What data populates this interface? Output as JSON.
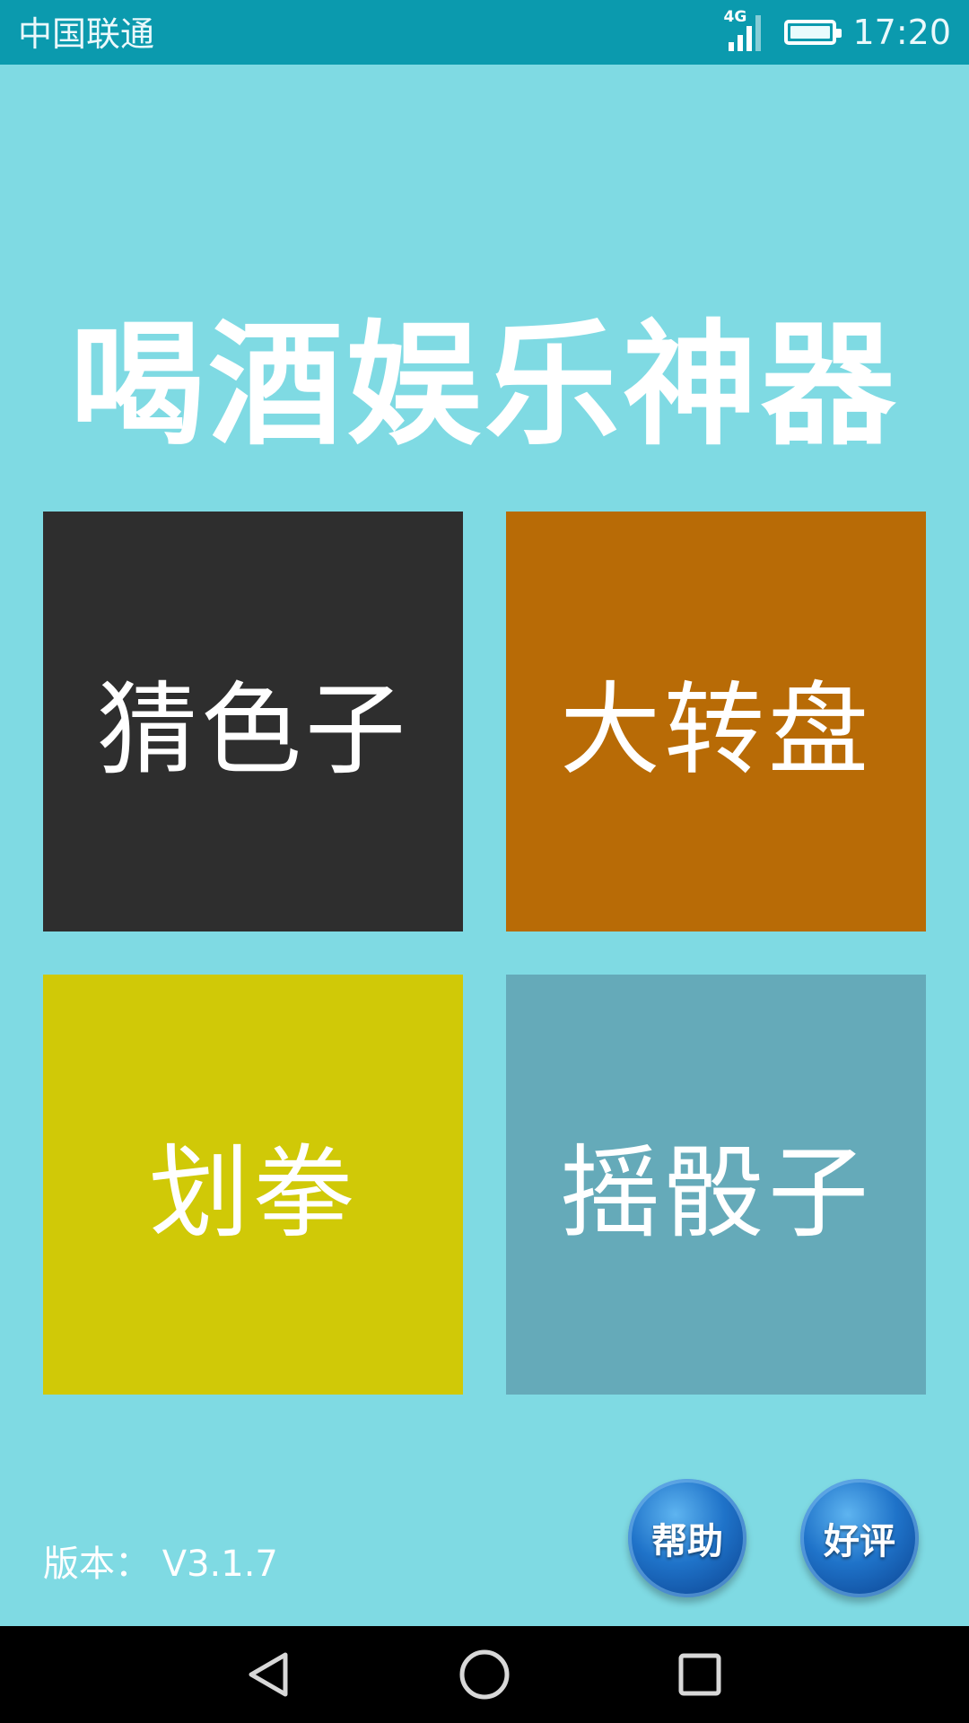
{
  "status_bar": {
    "carrier": "中国联通",
    "network": "4G",
    "time": "17:20"
  },
  "title": "喝酒娱乐神器",
  "tiles": [
    {
      "label": "猜色子",
      "color": "#2e2e2e"
    },
    {
      "label": "大转盘",
      "color": "#b86b06"
    },
    {
      "label": "划拳",
      "color": "#d0c907"
    },
    {
      "label": "摇骰子",
      "color": "#65aab9"
    }
  ],
  "footer": {
    "version": "版本： V3.1.7",
    "help_label": "帮助",
    "rate_label": "好评"
  },
  "nav_icons": [
    "back-icon",
    "home-icon",
    "recent-apps-icon"
  ],
  "colors": {
    "background": "#7fdae3",
    "status_bar": "#0b9aae",
    "round_button": "#1f73c9"
  }
}
